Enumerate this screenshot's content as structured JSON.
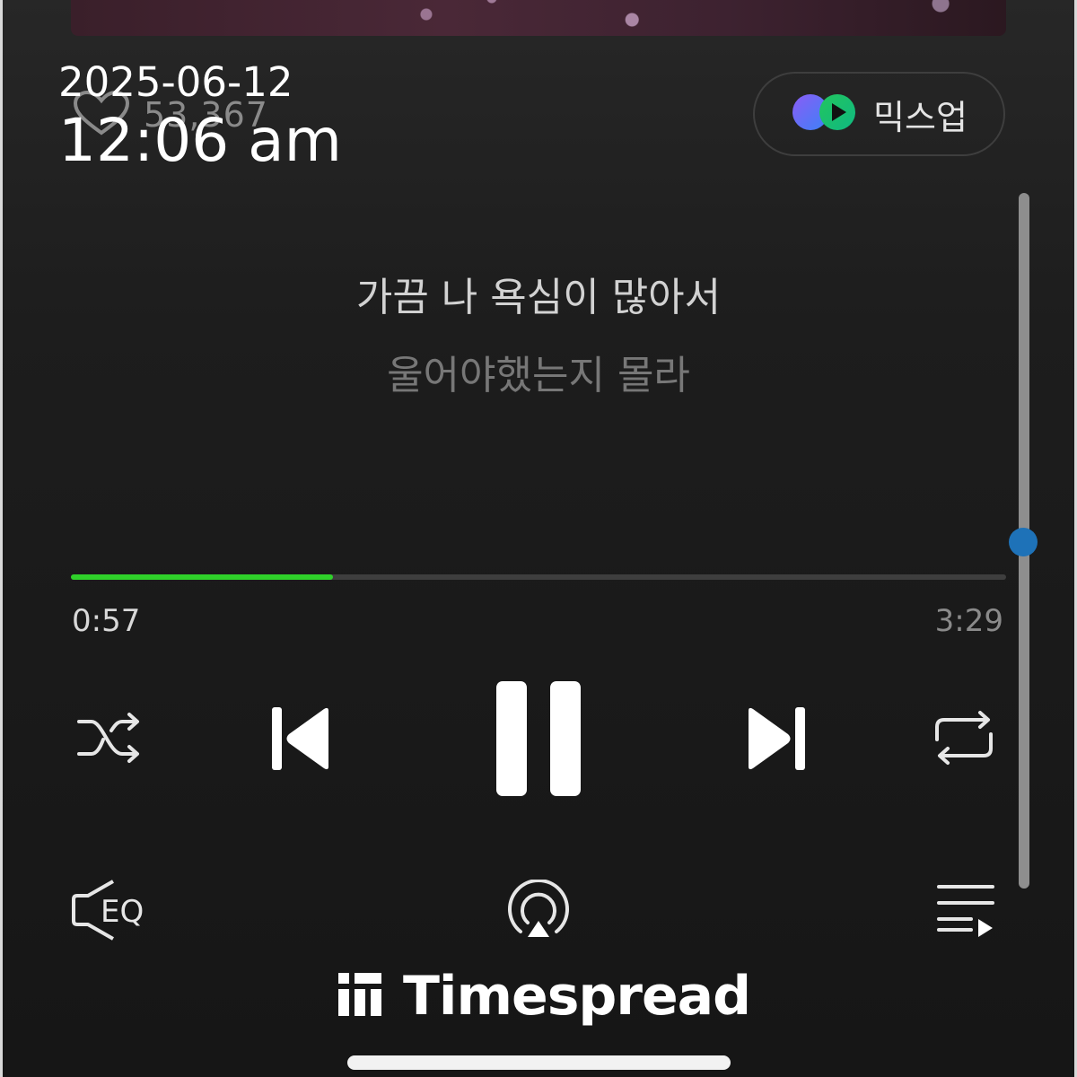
{
  "overlay": {
    "date": "2025-06-12",
    "time": "12:06 am"
  },
  "like": {
    "count": "53,367",
    "icon": "heart-outline-icon"
  },
  "mixup": {
    "label": "믹스업",
    "icon": "mixup-logo-icon"
  },
  "lyrics": {
    "current_line": "가끔 나 욕심이 많아서",
    "next_line": "울어야했는지 몰라"
  },
  "playback": {
    "current_time": "0:57",
    "total_time": "3:29",
    "progress_fraction": 0.28,
    "accent_color": "#2fd12a"
  },
  "controls": {
    "shuffle": "shuffle-icon",
    "previous": "skip-previous-icon",
    "play_pause": "pause-icon",
    "next": "skip-next-icon",
    "repeat": "repeat-icon"
  },
  "bottom_bar": {
    "eq": "eq-icon",
    "eq_text": "EQ",
    "airplay": "airplay-icon",
    "queue": "playlist-icon"
  },
  "brand": {
    "name": "Timespread",
    "icon": "timespread-logo-icon"
  }
}
